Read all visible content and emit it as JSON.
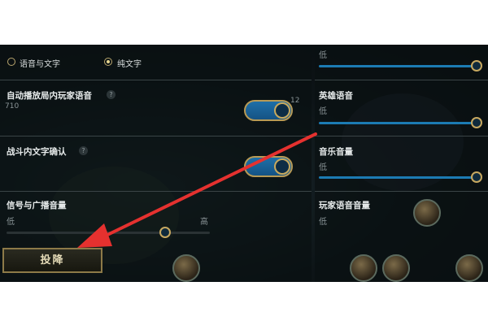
{
  "settings": {
    "chat_mode": {
      "option_voice_text": "语音与文字",
      "option_text_only": "纯文字",
      "selected": "纯文字"
    },
    "auto_play_voice": {
      "label": "自动播放局内玩家语音",
      "help": "?",
      "enabled": true
    },
    "in_battle_text_confirm": {
      "label": "战斗内文字确认",
      "help": "?",
      "enabled": true
    },
    "signal_volume": {
      "label": "信号与广播音量",
      "low_label": "低",
      "high_label": "高"
    },
    "right_panel": {
      "top_slider_low": "低",
      "hero_voice": {
        "label": "英雄语音",
        "low_label": "低"
      },
      "music_volume": {
        "label": "音乐音量",
        "low_label": "低"
      },
      "player_voice": {
        "label": "玩家语音音量",
        "low_label": "低"
      }
    }
  },
  "surrender_button": "投降",
  "background_digits": {
    "left": "710",
    "right": "12"
  },
  "colors": {
    "accent_blue": "#1c7bb3",
    "gold_border": "#b89a55",
    "arrow_red": "#e5312f"
  }
}
